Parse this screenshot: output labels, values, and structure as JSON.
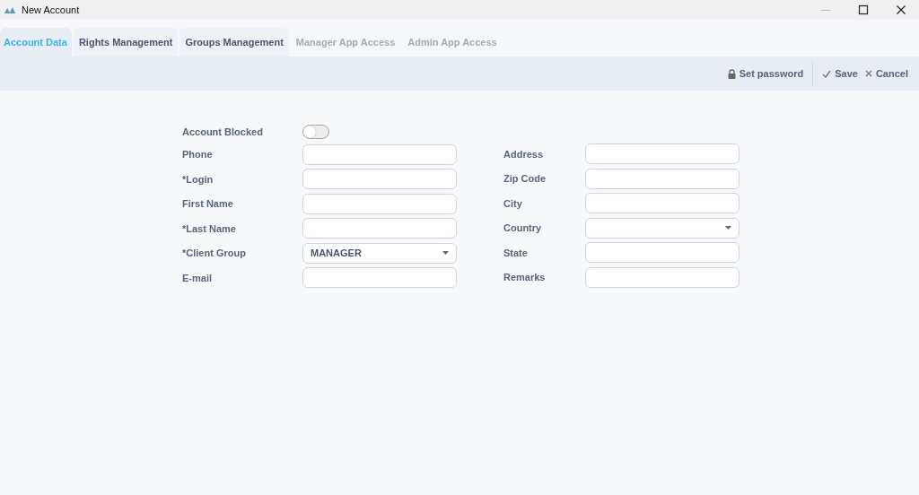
{
  "window": {
    "title": "New Account"
  },
  "tabs": [
    {
      "label": "Account Data",
      "selected": true,
      "disabled": false
    },
    {
      "label": "Rights Management",
      "selected": false,
      "disabled": false
    },
    {
      "label": "Groups Management",
      "selected": false,
      "disabled": false
    },
    {
      "label": "Manager App Access",
      "selected": false,
      "disabled": true
    },
    {
      "label": "Admin App Access",
      "selected": false,
      "disabled": true
    }
  ],
  "toolbar": [
    {
      "label": "Set password",
      "kind": "lock"
    },
    {
      "label": "Save",
      "kind": "check"
    },
    {
      "label": "Cancel",
      "kind": "cross"
    }
  ],
  "form": {
    "left": [
      {
        "label": "Account Blocked",
        "kind": "toggle",
        "on": false
      },
      {
        "label": "Phone",
        "kind": "text"
      },
      {
        "label": "*Login",
        "kind": "text"
      },
      {
        "label": "First Name",
        "kind": "text"
      },
      {
        "label": "*Last Name",
        "kind": "text"
      },
      {
        "label": "*Client Group",
        "kind": "select",
        "value": "MANAGER"
      },
      {
        "label": "E-mail",
        "kind": "text"
      }
    ],
    "right": [
      {
        "label": "Address",
        "kind": "text"
      },
      {
        "label": "Zip Code",
        "kind": "text"
      },
      {
        "label": "City",
        "kind": "text"
      },
      {
        "label": "Country",
        "kind": "select"
      },
      {
        "label": "State",
        "kind": "text"
      },
      {
        "label": "Remarks",
        "kind": "text"
      }
    ]
  }
}
